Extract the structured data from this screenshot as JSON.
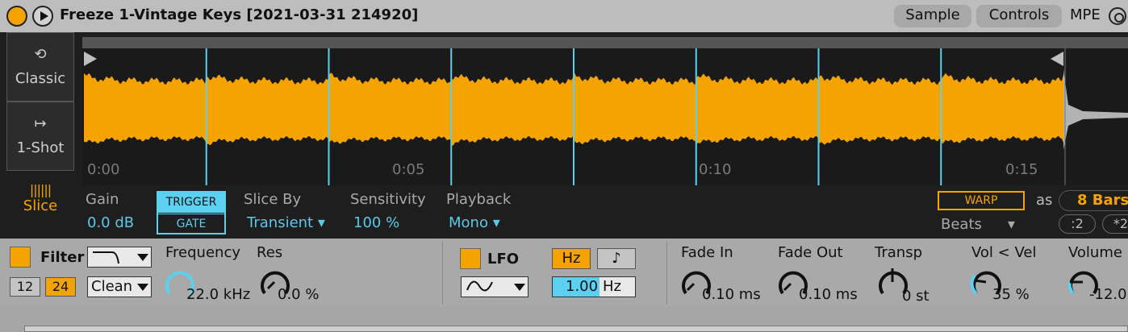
{
  "header": {
    "title": "Freeze 1-Vintage Keys [2021-03-31 214920]",
    "tabs": [
      "Sample",
      "Controls",
      "MPE"
    ],
    "active_tab": "Sample"
  },
  "modes": {
    "classic": "Classic",
    "oneshot": "1-Shot",
    "slice": "Slice",
    "active": "Slice"
  },
  "waveform": {
    "time_labels": [
      "0:00",
      "0:05",
      "0:10",
      "0:15"
    ],
    "slice_count": 8,
    "colors": {
      "wave": "#f5a300",
      "slice_marker": "#5bd0f0",
      "background": "#1a1a1a"
    }
  },
  "slice_controls": {
    "gain": {
      "label": "Gain",
      "value": "0.0 dB"
    },
    "trigger": {
      "trigger_label": "TRIGGER",
      "gate_label": "GATE"
    },
    "slice_by": {
      "label": "Slice By",
      "value": "Transient"
    },
    "sensitivity": {
      "label": "Sensitivity",
      "value": "100 %"
    },
    "playback": {
      "label": "Playback",
      "value": "Mono"
    },
    "warp": {
      "label": "WARP",
      "mode": "Beats",
      "as_label": "as",
      "bars": "8 Bars",
      "half": ":2",
      "double": "*2"
    }
  },
  "filter": {
    "label": "Filter",
    "type_icon": "lowpass-icon",
    "slope_12": "12",
    "slope_24": "24",
    "circuit": "Clean",
    "frequency": {
      "label": "Frequency",
      "value": "22.0 kHz"
    },
    "res": {
      "label": "Res",
      "value": "0.0 %"
    }
  },
  "lfo": {
    "label": "LFO",
    "wave_icon": "sine-wave-icon",
    "hz_label": "Hz",
    "note_icon": "♪",
    "rate": "1.00",
    "rate_unit": "Hz"
  },
  "envelope": {
    "fade_in": {
      "label": "Fade In",
      "value": "0.10 ms"
    },
    "fade_out": {
      "label": "Fade Out",
      "value": "0.10 ms"
    },
    "transp": {
      "label": "Transp",
      "value": "0 st"
    },
    "vol_vel": {
      "label": "Vol < Vel",
      "value": "35 %"
    },
    "volume": {
      "label": "Volume",
      "value": "-12.0"
    }
  },
  "accent": "#f5a300",
  "highlight": "#5bd0f0"
}
